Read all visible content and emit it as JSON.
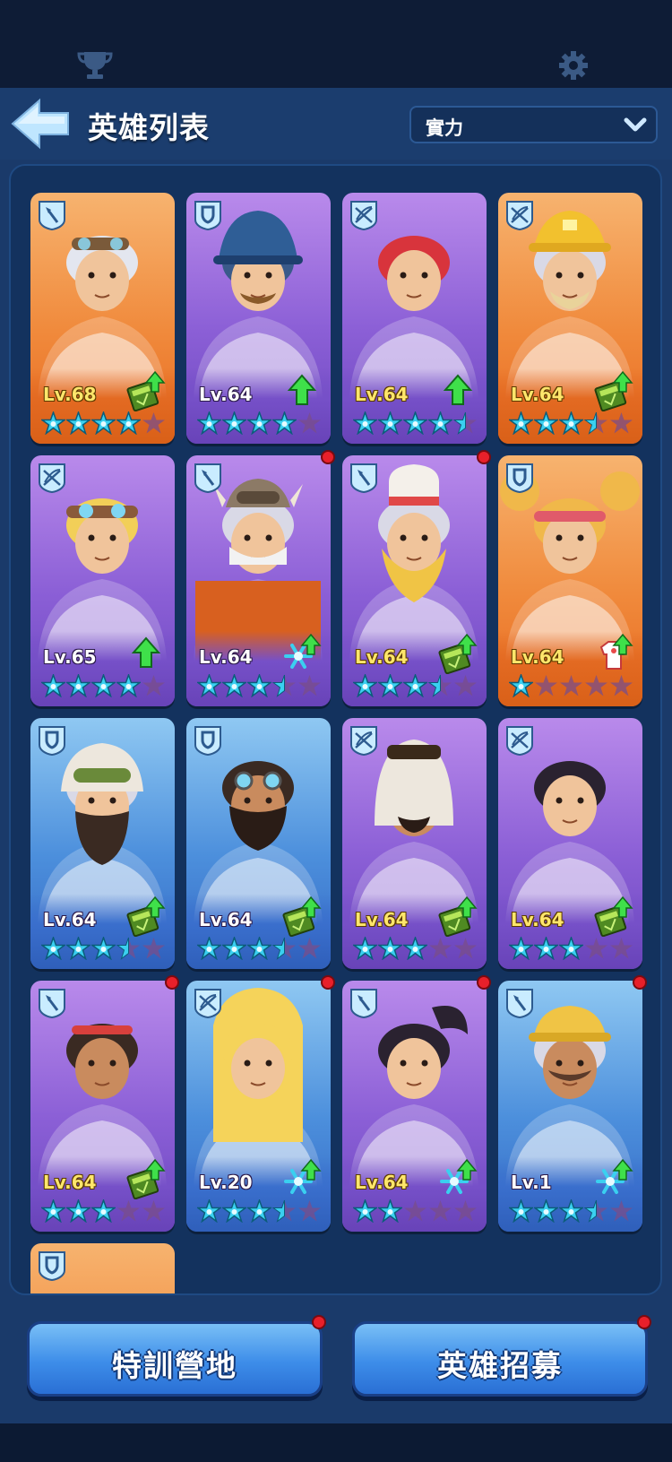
{
  "header": {
    "title": "英雄列表",
    "sort_value": "實力"
  },
  "buttons": {
    "training_camp": "特訓營地",
    "hero_recruit": "英雄招募"
  },
  "colors": {
    "star_active": "#3ad0f0",
    "star_inactive": "#7a4d8a",
    "notification": "#e8202a"
  },
  "heroes": [
    {
      "role": "shovel-icon",
      "level": "Lv.68",
      "stars": 4,
      "upgrade": "book-icon",
      "theme": "orange",
      "notify": false,
      "look": "silver-hair-goggles"
    },
    {
      "role": "shield-icon",
      "level": "Lv.64",
      "stars": 4,
      "upgrade": "arrow-icon",
      "theme": "purple",
      "notify": false,
      "look": "helmet-mustache"
    },
    {
      "role": "crossbow-icon",
      "level": "Lv.64",
      "stars": 4.5,
      "upgrade": "arrow-icon",
      "theme": "purple",
      "notify": false,
      "look": "red-hair"
    },
    {
      "role": "crossbow-icon",
      "level": "Lv.64",
      "stars": 3.5,
      "upgrade": "book-icon",
      "theme": "orange",
      "notify": false,
      "look": "hardhat"
    },
    {
      "role": "crossbow-icon",
      "level": "Lv.65",
      "stars": 4,
      "upgrade": "arrow-icon",
      "theme": "purple",
      "notify": false,
      "look": "blond-goggles"
    },
    {
      "role": "shovel-icon",
      "level": "Lv.64",
      "stars": 3.5,
      "upgrade": "snowflake-icon",
      "theme": "purple",
      "notify": true,
      "look": "viking"
    },
    {
      "role": "shovel-icon",
      "level": "Lv.64",
      "stars": 3.5,
      "upgrade": "book-icon",
      "theme": "purple",
      "notify": true,
      "look": "chef"
    },
    {
      "role": "shield-icon",
      "level": "Lv.64",
      "stars": 1,
      "upgrade": "coat-icon",
      "theme": "orange",
      "notify": false,
      "look": "pigtails"
    },
    {
      "role": "shield-icon",
      "level": "Lv.64",
      "stars": 3.5,
      "upgrade": "book-icon",
      "theme": "blue",
      "notify": false,
      "look": "fur-hat-beard"
    },
    {
      "role": "shield-icon",
      "level": "Lv.64",
      "stars": 3.5,
      "upgrade": "book-icon",
      "theme": "blue",
      "notify": false,
      "look": "goggles-beard"
    },
    {
      "role": "crossbow-icon",
      "level": "Lv.64",
      "stars": 3,
      "upgrade": "book-icon",
      "theme": "purple",
      "notify": false,
      "look": "desert-hood"
    },
    {
      "role": "crossbow-icon",
      "level": "Lv.64",
      "stars": 3,
      "upgrade": "book-icon",
      "theme": "purple",
      "notify": false,
      "look": "dark-hair-girl"
    },
    {
      "role": "shovel-icon",
      "level": "Lv.64",
      "stars": 3,
      "upgrade": "book-icon",
      "theme": "purple",
      "notify": true,
      "look": "headband"
    },
    {
      "role": "crossbow-icon",
      "level": "Lv.20",
      "stars": 3.5,
      "upgrade": "snowflake-icon",
      "theme": "blue",
      "notify": true,
      "look": "blonde-long-hair"
    },
    {
      "role": "shovel-icon",
      "level": "Lv.64",
      "stars": 2,
      "upgrade": "snowflake-icon",
      "theme": "purple",
      "notify": true,
      "look": "ponytail"
    },
    {
      "role": "shovel-icon",
      "level": "Lv.1",
      "stars": 3.5,
      "upgrade": "snowflake-icon",
      "theme": "blue",
      "notify": true,
      "look": "yellow-cap"
    },
    {
      "role": "shield-icon",
      "level": "",
      "stars": 0,
      "upgrade": "",
      "theme": "orange",
      "notify": false,
      "look": "partial"
    }
  ]
}
